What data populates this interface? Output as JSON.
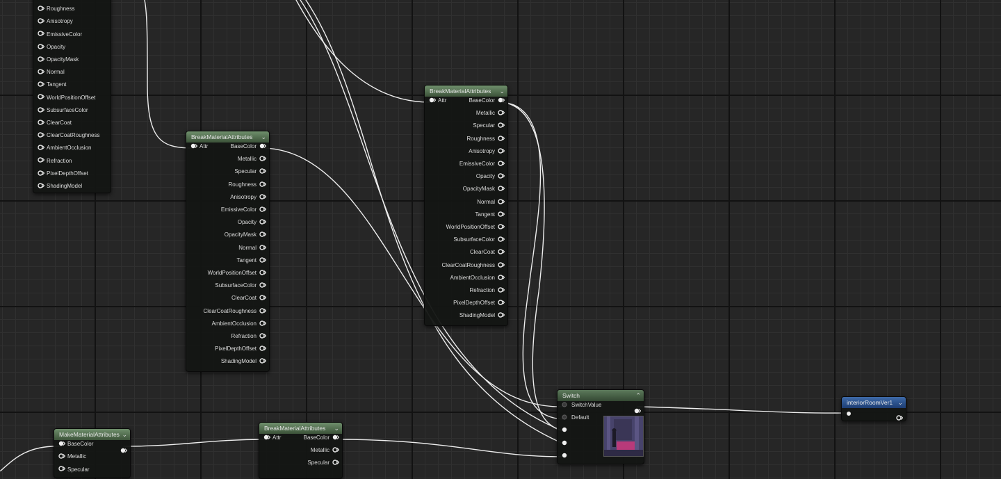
{
  "nodes": {
    "make_top": {
      "outputs": [
        "Roughness",
        "Anisotropy",
        "EmissiveColor",
        "Opacity",
        "OpacityMask",
        "Normal",
        "Tangent",
        "WorldPositionOffset",
        "SubsurfaceColor",
        "ClearCoat",
        "ClearCoatRoughness",
        "AmbientOcclusion",
        "Refraction",
        "PixelDepthOffset",
        "ShadingModel"
      ]
    },
    "break_1": {
      "title": "BreakMaterialAttributes",
      "input": "Attr",
      "outputs": [
        "BaseColor",
        "Metallic",
        "Specular",
        "Roughness",
        "Anisotropy",
        "EmissiveColor",
        "Opacity",
        "OpacityMask",
        "Normal",
        "Tangent",
        "WorldPositionOffset",
        "SubsurfaceColor",
        "ClearCoat",
        "ClearCoatRoughness",
        "AmbientOcclusion",
        "Refraction",
        "PixelDepthOffset",
        "ShadingModel"
      ]
    },
    "break_2": {
      "title": "BreakMaterialAttributes",
      "input": "Attr",
      "outputs": [
        "BaseColor",
        "Metallic",
        "Specular",
        "Roughness",
        "Anisotropy",
        "EmissiveColor",
        "Opacity",
        "OpacityMask",
        "Normal",
        "Tangent",
        "WorldPositionOffset",
        "SubsurfaceColor",
        "ClearCoat",
        "ClearCoatRoughness",
        "AmbientOcclusion",
        "Refraction",
        "PixelDepthOffset",
        "ShadingModel"
      ]
    },
    "make_bottom": {
      "title": "MakeMaterialAttributes",
      "inputs": [
        "BaseColor",
        "Metallic",
        "Specular"
      ]
    },
    "break_3": {
      "title": "BreakMaterialAttributes",
      "input": "Attr",
      "outputs": [
        "BaseColor",
        "Metallic",
        "Specular"
      ]
    },
    "switch": {
      "title": "Switch",
      "inputs": [
        "SwitchValue",
        "Default",
        "",
        "",
        ""
      ]
    },
    "output": {
      "title": "interiorRoomVer1"
    }
  },
  "icons": {
    "collapse": "chevron-down-icon",
    "expand": "chevron-up-icon"
  },
  "colors": {
    "grid_bg": "#262626",
    "wire": "#eeeeee",
    "header_green": "#5f7d5c",
    "header_blue": "#2c5494"
  }
}
